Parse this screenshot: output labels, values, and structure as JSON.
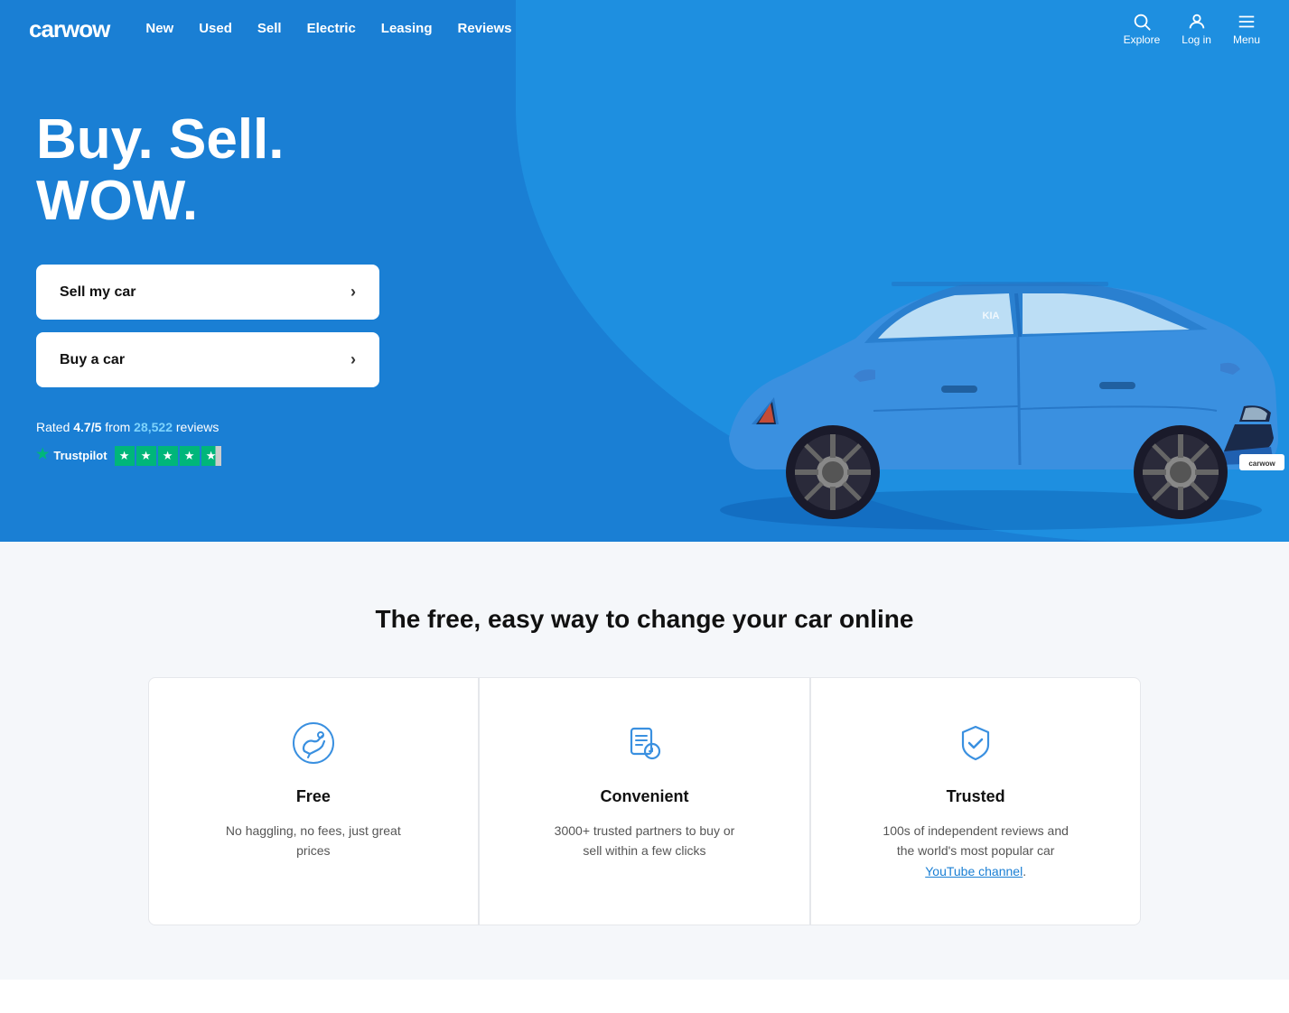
{
  "nav": {
    "logo": "carwow",
    "links": [
      {
        "label": "New",
        "href": "#"
      },
      {
        "label": "Used",
        "href": "#"
      },
      {
        "label": "Sell",
        "href": "#"
      },
      {
        "label": "Electric",
        "href": "#"
      },
      {
        "label": "Leasing",
        "href": "#"
      },
      {
        "label": "Reviews",
        "href": "#"
      }
    ],
    "explore_label": "Explore",
    "login_label": "Log in",
    "menu_label": "Menu"
  },
  "hero": {
    "title": "Buy. Sell. WOW.",
    "sell_button": "Sell my car",
    "buy_button": "Buy a car",
    "rating_text": "Rated ",
    "rating_score": "4.7/5",
    "rating_from": " from ",
    "review_count": "28,522",
    "rating_suffix": " reviews",
    "trustpilot_label": "Trustpilot"
  },
  "features": {
    "section_title": "The free, easy way to change your car online",
    "cards": [
      {
        "icon": "handshake",
        "name": "Free",
        "description": "No haggling, no fees, just great prices"
      },
      {
        "icon": "document",
        "name": "Convenient",
        "description": "3000+ trusted partners to buy or sell within a few clicks"
      },
      {
        "icon": "shield-check",
        "name": "Trusted",
        "description": "100s of independent reviews and the world's most popular car ",
        "link_text": "YouTube channel",
        "link_href": "#"
      }
    ]
  }
}
